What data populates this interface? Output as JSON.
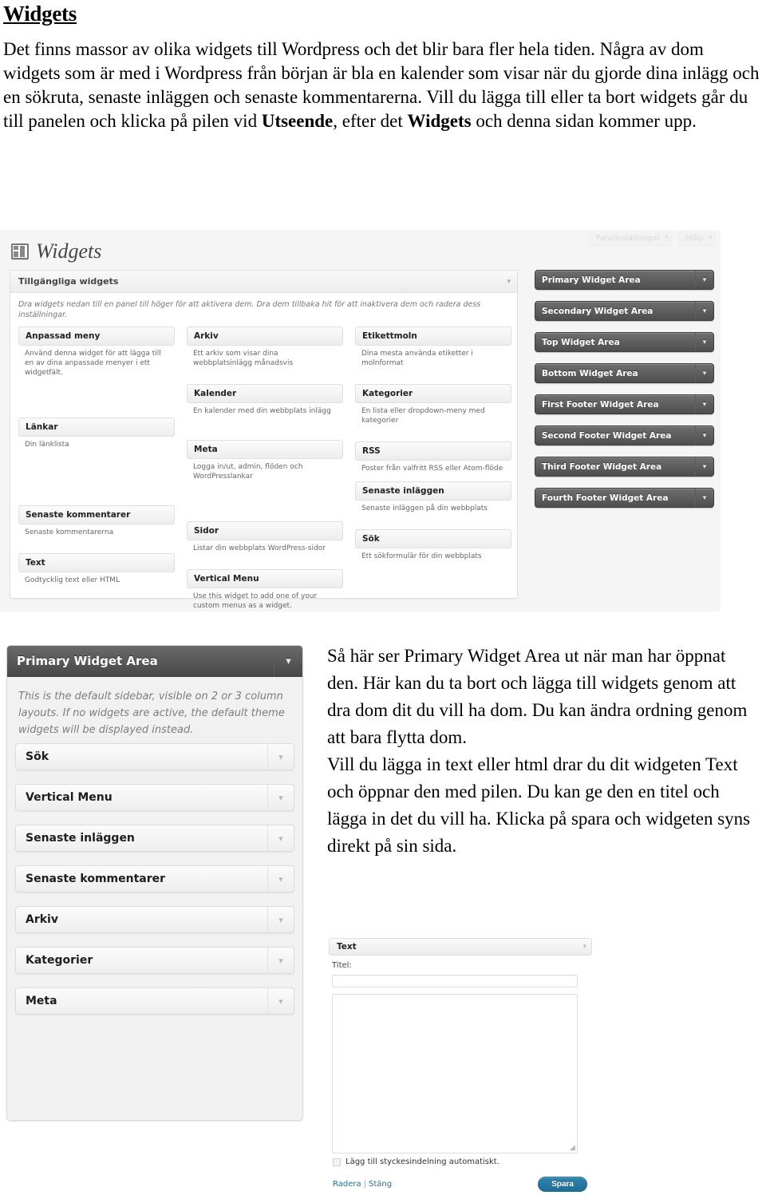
{
  "document": {
    "title": "Widgets",
    "intro_paragraph": "Det finns massor av olika widgets till Wordpress och det blir bara fler hela tiden. Några av dom widgets som är med i Wordpress från början är bla en kalender som visar när du gjorde dina inlägg och en sökruta, senaste inläggen och senaste kommentarerna. Vill du lägga till eller ta bort widgets går du till panelen och klicka på pilen vid ",
    "intro_bold_1": "Utseende",
    "intro_mid": ", efter det ",
    "intro_bold_2": "Widgets",
    "intro_end": " och denna sidan kommer upp.",
    "side_paragraph_1": "Så här ser Primary Widget Area ut när man har öppnat den. Här kan du ta bort och lägga till widgets genom att dra dom dit du vill ha dom. Du kan ändra ordning genom att bara flytta dom.",
    "side_paragraph_2": "Vill du lägga in text eller html drar du dit widgeten Text och öppnar den med pilen. Du kan ge den en titel och lägga in det du vill ha. Klicka på spara och widgeten syns direkt på sin sida."
  },
  "admin_screenshot": {
    "page_title": "Widgets",
    "page_icon": "widgets-icon",
    "top_tabs": [
      {
        "label": "Panelinställningar",
        "icon": "chevron-down-icon"
      },
      {
        "label": "Hjälp",
        "icon": "chevron-down-icon"
      }
    ],
    "available_panel": {
      "heading": "Tillgängliga widgets",
      "toggle_icon": "chevron-down-icon",
      "description": "Dra widgets nedan till en panel till höger för att aktivera dem. Dra dem tillbaka hit för att inaktivera dem och radera dess inställningar.",
      "columns": [
        {
          "items": [
            {
              "title": "Anpassad meny",
              "desc": "Använd denna widget för att lägga till en av dina anpassade menyer i ett widgetfält.",
              "spacers_after": 2
            },
            {
              "title": "Länkar",
              "desc": "Din länklista",
              "spacers_after": 1
            },
            {
              "title": "Senaste kommentarer",
              "desc": "Senaste kommentarerna",
              "spacers_after": 0
            },
            {
              "title": "Text",
              "desc": "Godtycklig text eller HTML",
              "spacers_after": 0
            }
          ]
        },
        {
          "items": [
            {
              "title": "Arkiv",
              "desc": "Ett arkiv som visar dina webbplatsinlägg månadsvis",
              "spacers_after": 0
            },
            {
              "title": "Kalender",
              "desc": "En kalender med din webbplats inlägg",
              "spacers_after": 1
            },
            {
              "title": "Meta",
              "desc": "Logga in/ut, admin, flöden och WordPresslankar",
              "spacers_after": 1
            },
            {
              "title": "Sidor",
              "desc": "Listar din webbplats WordPress-sidor",
              "spacers_after": 0
            },
            {
              "title": "Vertical Menu",
              "desc": "Use this widget to add one of your custom menus as a widget.",
              "spacers_after": 0
            }
          ]
        },
        {
          "items": [
            {
              "title": "Etikettmoln",
              "desc": "Dina mesta använda etiketter i molnformat",
              "spacers_after": 0
            },
            {
              "title": "Kategorier",
              "desc": "En lista eller dropdown-meny med kategorier",
              "spacers_after": 0
            },
            {
              "title": "RSS",
              "desc": "Poster från valfritt RSS eller Atom-flöde",
              "spacers_after": 0
            },
            {
              "title": "Senaste inläggen",
              "desc": "Senaste inläggen på din webbplats",
              "spacers_after": 0
            },
            {
              "title": "Sök",
              "desc": "Ett sökformulär för din webbplats",
              "spacers_after": 0
            }
          ]
        }
      ]
    },
    "sidebar_areas": [
      {
        "label": "Primary Widget Area",
        "icon": "chevron-down-icon"
      },
      {
        "label": "Secondary Widget Area",
        "icon": "chevron-down-icon"
      },
      {
        "label": "Top Widget Area",
        "icon": "chevron-down-icon"
      },
      {
        "label": "Bottom Widget Area",
        "icon": "chevron-down-icon"
      },
      {
        "label": "First Footer Widget Area",
        "icon": "chevron-down-icon"
      },
      {
        "label": "Second Footer Widget Area",
        "icon": "chevron-down-icon"
      },
      {
        "label": "Third Footer Widget Area",
        "icon": "chevron-down-icon"
      },
      {
        "label": "Fourth Footer Widget Area",
        "icon": "chevron-down-icon"
      }
    ],
    "colors": {
      "sidebar_button": "#5b5b5b",
      "panel_bg": "#f5f5f5",
      "border": "#dfdfdf"
    }
  },
  "primary_area_screenshot": {
    "header": "Primary Widget Area",
    "header_icon": "chevron-down-icon",
    "description": "This is the default sidebar, visible on 2 or 3 column layouts. If no widgets are active, the default theme widgets will be displayed instead.",
    "widgets": [
      {
        "label": "Sök",
        "icon": "chevron-down-icon"
      },
      {
        "label": "Vertical Menu",
        "icon": "chevron-down-icon"
      },
      {
        "label": "Senaste inläggen",
        "icon": "chevron-down-icon"
      },
      {
        "label": "Senaste kommentarer",
        "icon": "chevron-down-icon"
      },
      {
        "label": "Arkiv",
        "icon": "chevron-down-icon"
      },
      {
        "label": "Kategorier",
        "icon": "chevron-down-icon"
      },
      {
        "label": "Meta",
        "icon": "chevron-down-icon"
      }
    ]
  },
  "text_widget_screenshot": {
    "header": "Text",
    "header_icon": "chevron-down-icon",
    "title_label": "Titel:",
    "title_value": "",
    "content_value": "",
    "checkbox_label": "Lägg till styckesindelning automatiskt.",
    "checkbox_checked": false,
    "delete_link": "Radera",
    "separator": "|",
    "close_link": "Stäng",
    "save_button": "Spara",
    "save_color": "#21759b",
    "resize_icon": "resize-grip-icon"
  }
}
